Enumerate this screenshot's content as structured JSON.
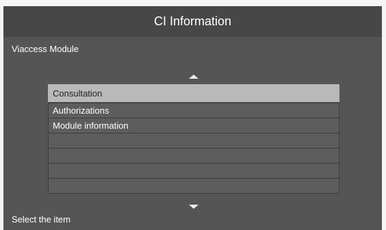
{
  "header": {
    "title": "CI Information"
  },
  "subtitle": "Viaccess Module",
  "menu": {
    "items": [
      {
        "label": "Consultation",
        "selected": true
      },
      {
        "label": "Authorizations",
        "selected": false
      },
      {
        "label": "Module information",
        "selected": false
      },
      {
        "label": "",
        "selected": false
      },
      {
        "label": "",
        "selected": false
      },
      {
        "label": "",
        "selected": false
      },
      {
        "label": "",
        "selected": false
      }
    ],
    "scroll_up_icon": "triangle-up-icon",
    "scroll_down_icon": "triangle-down-icon"
  },
  "footer": {
    "hint": "Select the item"
  },
  "colors": {
    "background": "#555555",
    "header": "#474747",
    "selected_row": "#b9b9b9",
    "row": "#5d5d5d"
  }
}
